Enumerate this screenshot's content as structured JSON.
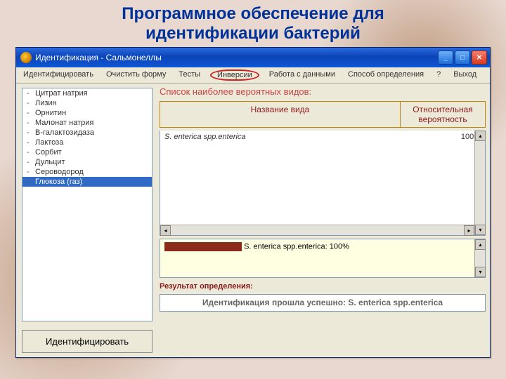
{
  "slide_title_line1": "Программное обеспечение для",
  "slide_title_line2": "идентификации бактерий",
  "window": {
    "title": "Идентификация - Сальмонеллы"
  },
  "menu": {
    "identify": "Идентифицировать",
    "clear": "Очистить форму",
    "tests": "Тесты",
    "inversions": "Инверсии",
    "data": "Работа с данными",
    "method": "Способ определения",
    "help": "?",
    "exit": "Выход"
  },
  "tests": [
    {
      "label": "Цитрат натрия"
    },
    {
      "label": "Лизин"
    },
    {
      "label": "Орнитин"
    },
    {
      "label": "Малонат натрия"
    },
    {
      "label": "B-галактозидаза"
    },
    {
      "label": "Лактоза"
    },
    {
      "label": "Сорбит"
    },
    {
      "label": "Дульцит"
    },
    {
      "label": "Сероводород"
    },
    {
      "label": "Глюкоза (газ)",
      "selected": true
    }
  ],
  "identify_button": "Идентифицировать",
  "right": {
    "heading": "Список наиболее вероятных видов:",
    "col_name": "Название вида",
    "col_prob": "Относительная вероятность",
    "rows": [
      {
        "name": "S. enterica spp.enterica",
        "prob": "100%"
      }
    ],
    "lower_text": "S. enterica spp.enterica: 100%",
    "result_label": "Результат определения:",
    "result_text": "Идентификация прошла успешно: S. enterica spp.enterica"
  }
}
